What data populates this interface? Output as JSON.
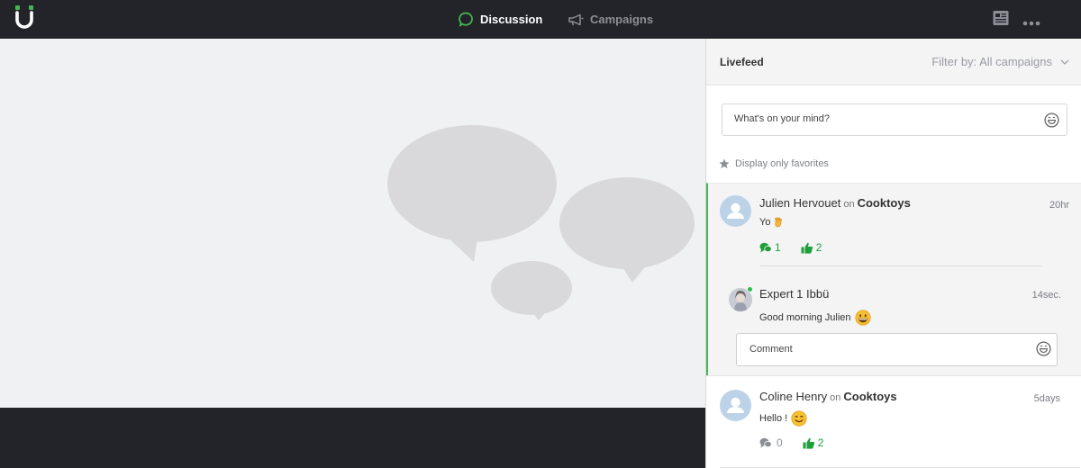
{
  "app": {
    "logo_icon": "ubu-logo-icon",
    "brand_color": "#46b652"
  },
  "topnav": {
    "discussion_label": "Discussion",
    "campaigns_label": "Campaigns",
    "active_tab": "Discussion",
    "icons": [
      "chat-bubble-icon",
      "megaphone-icon",
      "newspaper-icon",
      "more-dots-icon"
    ]
  },
  "livefeed": {
    "title": "Livefeed",
    "filter_label": "Filter by: All campaigns",
    "composer_placeholder": "What's on your mind?",
    "favorites_label": "Display only favorites",
    "posts": [
      {
        "author": "Julien Hervouet",
        "on": "on",
        "campaign": "Cooktoys",
        "time": "20hr",
        "message": "Yo",
        "message_emoji": "vulcan-salute-icon",
        "comments": "1",
        "likes": "2",
        "comment_color": "#1f9f3c",
        "like_color": "#1f9f3c",
        "reply": {
          "author": "Expert 1 Ibbü",
          "time": "14sec.",
          "message": "Good morning Julien",
          "message_emoji": "grinning-face-icon",
          "online": true
        },
        "comment_placeholder": "Comment"
      },
      {
        "author": "Coline Henry",
        "on": "on",
        "campaign": "Cooktoys",
        "time": "5days",
        "message": "Hello !",
        "message_emoji": "smiling-face-icon",
        "comments": "0",
        "likes": "2",
        "comment_color": "#8c8e95",
        "like_color": "#1f9f3c"
      }
    ]
  }
}
